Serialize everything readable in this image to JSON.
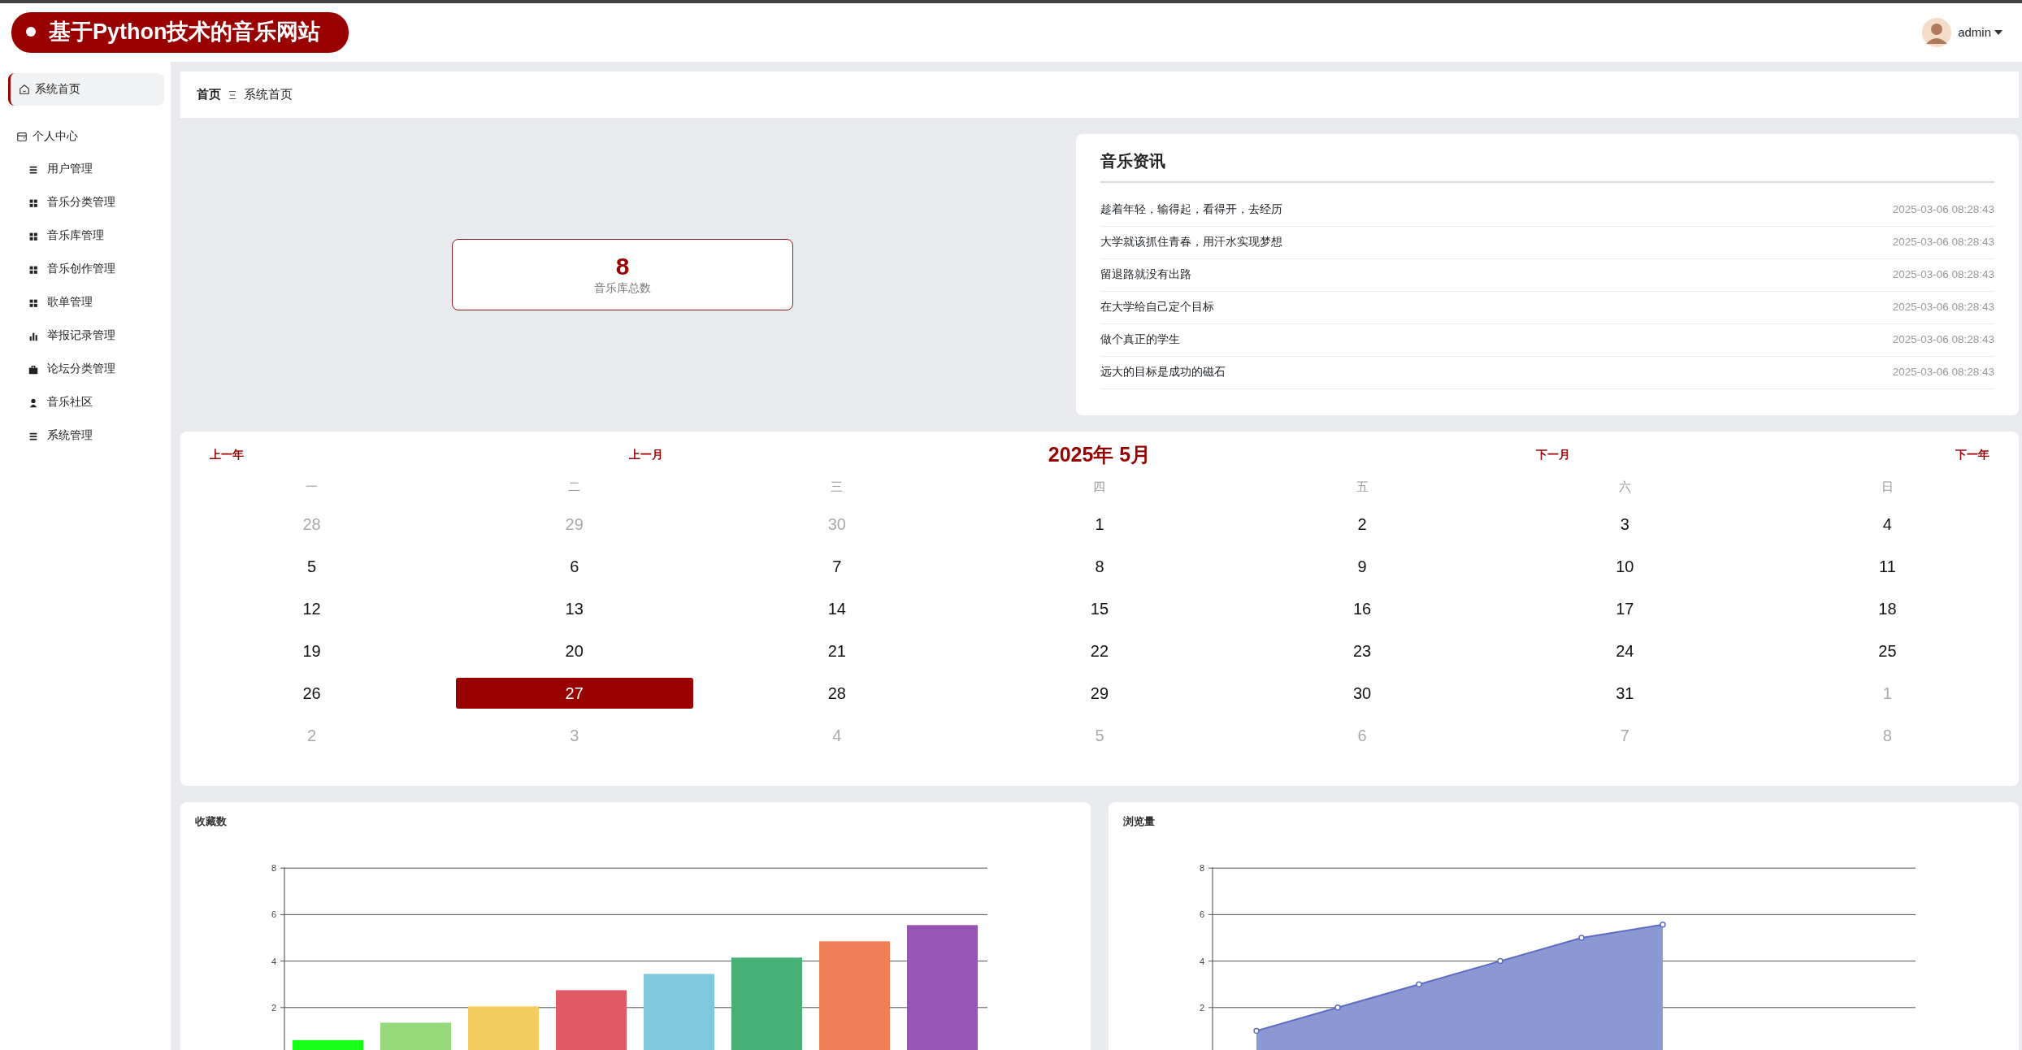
{
  "header": {
    "title": "基于Python技术的音乐网站",
    "user": "admin"
  },
  "sidebar": {
    "items": [
      {
        "label": "系统首页",
        "selected": true
      },
      {
        "label": "个人中心",
        "selected": false,
        "children": [
          {
            "label": "用户管理",
            "selected": false
          },
          {
            "label": "音乐分类管理",
            "selected": false
          },
          {
            "label": "音乐库管理",
            "selected": false
          },
          {
            "label": "音乐创作管理",
            "selected": false
          },
          {
            "label": "歌单管理",
            "selected": false
          },
          {
            "label": "举报记录管理",
            "selected": false
          },
          {
            "label": "论坛分类管理",
            "selected": false
          },
          {
            "label": "音乐社区",
            "selected": false
          },
          {
            "label": "系统管理",
            "selected": false
          }
        ]
      }
    ]
  },
  "breadcrumb": [
    "首页",
    "系统首页"
  ],
  "stat": {
    "value": "8",
    "label": "音乐库总数"
  },
  "news": {
    "title": "音乐资讯",
    "items": [
      {
        "title": "趁着年轻，输得起，看得开，去经历",
        "date": "2025-03-06 08:28:43"
      },
      {
        "title": "大学就该抓住青春，用汗水实现梦想",
        "date": "2025-03-06 08:28:43"
      },
      {
        "title": "留退路就没有出路",
        "date": "2025-03-06 08:28:43"
      },
      {
        "title": "在大学给自己定个目标",
        "date": "2025-03-06 08:28:43"
      },
      {
        "title": "做个真正的学生",
        "date": "2025-03-06 08:28:43"
      },
      {
        "title": "远大的目标是成功的磁石",
        "date": "2025-03-06 08:28:43"
      }
    ]
  },
  "calendar": {
    "prev_year": "上一年",
    "prev_month": "上一月",
    "title": "2025年 5月",
    "next_month": "下一月",
    "next_year": "下一年",
    "weekdays": [
      "一",
      "二",
      "三",
      "四",
      "五",
      "六",
      "日"
    ],
    "weeks": [
      [
        {
          "day": "28",
          "muted": true,
          "selected": false
        },
        {
          "day": "29",
          "muted": true,
          "selected": false
        },
        {
          "day": "30",
          "muted": true,
          "selected": false
        },
        {
          "day": "1",
          "muted": false,
          "selected": false
        },
        {
          "day": "2",
          "muted": false,
          "selected": false
        },
        {
          "day": "3",
          "muted": false,
          "selected": false
        },
        {
          "day": "4",
          "muted": false,
          "selected": false
        }
      ],
      [
        {
          "day": "5",
          "muted": false,
          "selected": false
        },
        {
          "day": "6",
          "muted": false,
          "selected": false
        },
        {
          "day": "7",
          "muted": false,
          "selected": false
        },
        {
          "day": "8",
          "muted": false,
          "selected": false
        },
        {
          "day": "9",
          "muted": false,
          "selected": false
        },
        {
          "day": "10",
          "muted": false,
          "selected": false
        },
        {
          "day": "11",
          "muted": false,
          "selected": false
        }
      ],
      [
        {
          "day": "12",
          "muted": false,
          "selected": false
        },
        {
          "day": "13",
          "muted": false,
          "selected": false
        },
        {
          "day": "14",
          "muted": false,
          "selected": false
        },
        {
          "day": "15",
          "muted": false,
          "selected": false
        },
        {
          "day": "16",
          "muted": false,
          "selected": false
        },
        {
          "day": "17",
          "muted": false,
          "selected": false
        },
        {
          "day": "18",
          "muted": false,
          "selected": false
        }
      ],
      [
        {
          "day": "19",
          "muted": false,
          "selected": false
        },
        {
          "day": "20",
          "muted": false,
          "selected": false
        },
        {
          "day": "21",
          "muted": false,
          "selected": false
        },
        {
          "day": "22",
          "muted": false,
          "selected": false
        },
        {
          "day": "23",
          "muted": false,
          "selected": false
        },
        {
          "day": "24",
          "muted": false,
          "selected": false
        },
        {
          "day": "25",
          "muted": false,
          "selected": false
        }
      ],
      [
        {
          "day": "26",
          "muted": false,
          "selected": false
        },
        {
          "day": "27",
          "muted": false,
          "selected": true
        },
        {
          "day": "28",
          "muted": false,
          "selected": false
        },
        {
          "day": "29",
          "muted": false,
          "selected": false
        },
        {
          "day": "30",
          "muted": false,
          "selected": false
        },
        {
          "day": "31",
          "muted": false,
          "selected": false
        },
        {
          "day": "1",
          "muted": true,
          "selected": false
        }
      ],
      [
        {
          "day": "2",
          "muted": true,
          "selected": false
        },
        {
          "day": "3",
          "muted": true,
          "selected": false
        },
        {
          "day": "4",
          "muted": true,
          "selected": false
        },
        {
          "day": "5",
          "muted": true,
          "selected": false
        },
        {
          "day": "6",
          "muted": true,
          "selected": false
        },
        {
          "day": "7",
          "muted": true,
          "selected": false
        },
        {
          "day": "8",
          "muted": true,
          "selected": false
        }
      ]
    ]
  },
  "charts": [
    {
      "title": "收藏数",
      "chart_data": {
        "type": "bar",
        "values": [
          0.6,
          1.35,
          2.05,
          2.75,
          3.45,
          4.15,
          4.85,
          5.55
        ],
        "colors": [
          "#16ff16",
          "#95d97a",
          "#f4cc60",
          "#e05a67",
          "#7ec8dc",
          "#47b074",
          "#f07f56",
          "#9655b0"
        ],
        "ylim": [
          0,
          8
        ],
        "yticks": [
          2,
          4,
          6,
          8
        ],
        "grid": true
      }
    },
    {
      "title": "浏览量",
      "chart_data": {
        "type": "area",
        "series": [
          {
            "color": "#8a99d4",
            "values": [
              1,
              2,
              3,
              4,
              5,
              5.57
            ]
          }
        ],
        "ylim": [
          0,
          8
        ],
        "yticks": [
          2,
          4,
          6,
          8
        ],
        "grid": true
      }
    }
  ]
}
